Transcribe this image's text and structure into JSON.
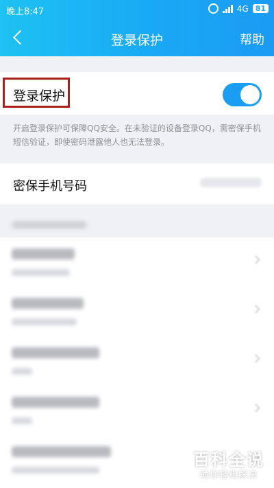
{
  "status_bar": {
    "time": "晚上8:47",
    "network": "4G",
    "battery": "81"
  },
  "navbar": {
    "title": "登录保护",
    "help_label": "帮助"
  },
  "login_protect": {
    "label": "登录保护",
    "enabled": true
  },
  "description": "开启登录保护可保障QQ安全。在未验证的设备登录QQ，需密保手机短信验证，即使密码泄露他人也无法登录。",
  "phone": {
    "label": "密保手机号码"
  },
  "devices": [
    {
      "name": "Redmi Note 4X",
      "sub": "Redmi Note 4X"
    },
    {
      "name": "PC-LUYANG",
      "sub": ""
    },
    {
      "name": "PC201805121211",
      "sub": ""
    },
    {
      "name": "PC201805121211",
      "sub": ""
    },
    {
      "name": "PC-20090820005A",
      "sub": ""
    }
  ],
  "watermark": {
    "title": "百科全说",
    "subtitle": "助你轻松解决"
  },
  "colors": {
    "header_start": "#1ec2f3",
    "header_end": "#1a9bf4",
    "toggle_on": "#1a9ef4",
    "highlight_box": "#a8201a"
  }
}
